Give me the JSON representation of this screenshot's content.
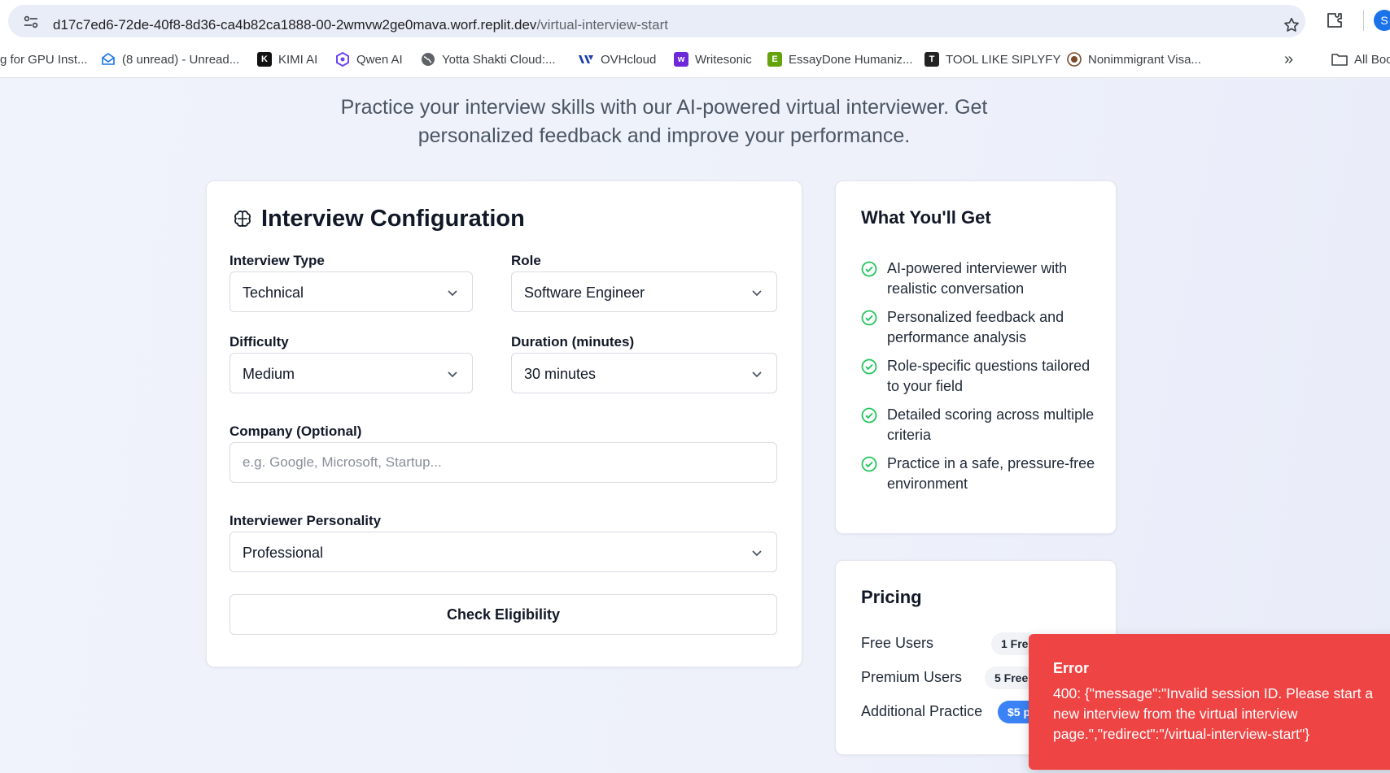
{
  "browser": {
    "url_host": "d17c7ed6-72de-40f8-8d36-ca4b82ca1888-00-2wmvw2ge0mava.worf.replit.dev",
    "url_path": "/virtual-interview-start",
    "profile_initial": "S",
    "bookmarks": [
      {
        "label": "g for GPU Inst...",
        "icon": "none",
        "color": ""
      },
      {
        "label": "(8 unread) - Unread...",
        "icon": "mail-icon",
        "color": "#1a73e8"
      },
      {
        "label": "KIMI AI",
        "icon": "kimi-icon",
        "color": "#111111"
      },
      {
        "label": "Qwen AI",
        "icon": "qwen-icon",
        "color": "#6b46f5"
      },
      {
        "label": "Yotta Shakti Cloud:...",
        "icon": "globe-icon",
        "color": "#5f6368"
      },
      {
        "label": "OVHcloud",
        "icon": "ovh-icon",
        "color": "#1c3fae"
      },
      {
        "label": "Writesonic",
        "icon": "writesonic-icon",
        "color": "#6d28d9"
      },
      {
        "label": "EssayDone Humaniz...",
        "icon": "essaydone-icon",
        "color": "#65a30d"
      },
      {
        "label": "TOOL LIKE SIPLYFY",
        "icon": "tool-icon",
        "color": "#222222"
      },
      {
        "label": "Nonimmigrant Visa...",
        "icon": "seal-icon",
        "color": "#7a4a2a"
      }
    ],
    "overflow_label": "»",
    "all_bookmarks_label": "All Boo"
  },
  "page": {
    "subtitle": "Practice your interview skills with our AI-powered virtual interviewer. Get personalized feedback and improve your performance."
  },
  "config": {
    "title": "Interview Configuration",
    "interview_type": {
      "label": "Interview Type",
      "value": "Technical"
    },
    "role": {
      "label": "Role",
      "value": "Software Engineer"
    },
    "difficulty": {
      "label": "Difficulty",
      "value": "Medium"
    },
    "duration": {
      "label": "Duration (minutes)",
      "value": "30 minutes"
    },
    "company": {
      "label": "Company (Optional)",
      "placeholder": "e.g. Google, Microsoft, Startup..."
    },
    "personality": {
      "label": "Interviewer Personality",
      "value": "Professional"
    },
    "check_button": "Check Eligibility"
  },
  "benefits": {
    "title": "What You'll Get",
    "items": [
      "AI-powered interviewer with realistic conversation",
      "Personalized feedback and performance analysis",
      "Role-specific questions tailored to your field",
      "Detailed scoring across multiple criteria",
      "Practice in a safe, pressure-free environment"
    ],
    "check_color": "#22c55e"
  },
  "pricing": {
    "title": "Pricing",
    "rows": [
      {
        "label": "Free Users",
        "badge": "1 Fre"
      },
      {
        "label": "Premium Users",
        "badge": "5 Free"
      },
      {
        "label": "Additional Practice",
        "badge": "$5 p"
      }
    ]
  },
  "toast": {
    "title": "Error",
    "message": "400: {\"message\":\"Invalid session ID. Please start a new interview from the virtual interview page.\",\"redirect\":\"/virtual-interview-start\"}",
    "color": "#ef4444"
  }
}
